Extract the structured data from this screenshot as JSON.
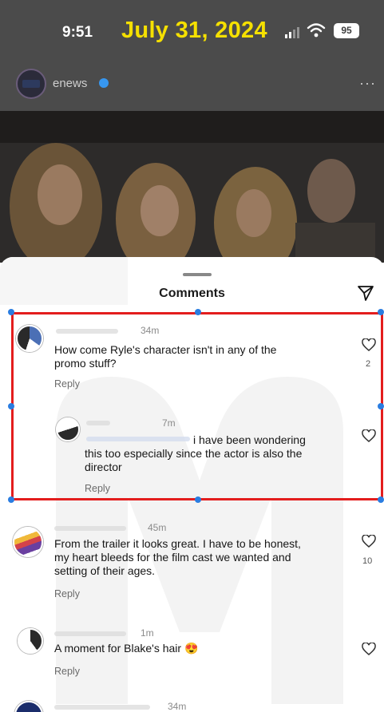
{
  "overlay": {
    "date": "July 31, 2024"
  },
  "status_bar": {
    "time": "9:51",
    "battery": "95",
    "icons": [
      "cellular-signal-icon",
      "wifi-icon",
      "battery-icon"
    ]
  },
  "post": {
    "username": "enews",
    "more_icon": "more-dots-icon"
  },
  "comments_sheet": {
    "title": "Comments",
    "share_icon": "send-icon",
    "comments": [
      {
        "time": "34m",
        "text_lines": [
          "How come Ryle's character isn't in any of the",
          "promo stuff?"
        ],
        "reply": "Reply",
        "likes": "2"
      },
      {
        "time": "7m",
        "text_lines": [
          "i have been wondering",
          "this too especially since the actor is also the",
          "director"
        ],
        "reply": "Reply",
        "likes": ""
      },
      {
        "time": "45m",
        "text_lines": [
          "From the trailer it looks great. I have to be honest,",
          "my heart bleeds for the film cast we wanted and",
          "setting of their ages."
        ],
        "reply": "Reply",
        "likes": "10"
      },
      {
        "time": "1m",
        "text": "A moment for Blake's hair",
        "emoji": "😍",
        "reply": "Reply",
        "likes": ""
      },
      {
        "time": "34m"
      }
    ]
  },
  "colors": {
    "highlight": "#e31d1d",
    "overlay_date": "#f5e000",
    "verified": "#3797f0"
  }
}
